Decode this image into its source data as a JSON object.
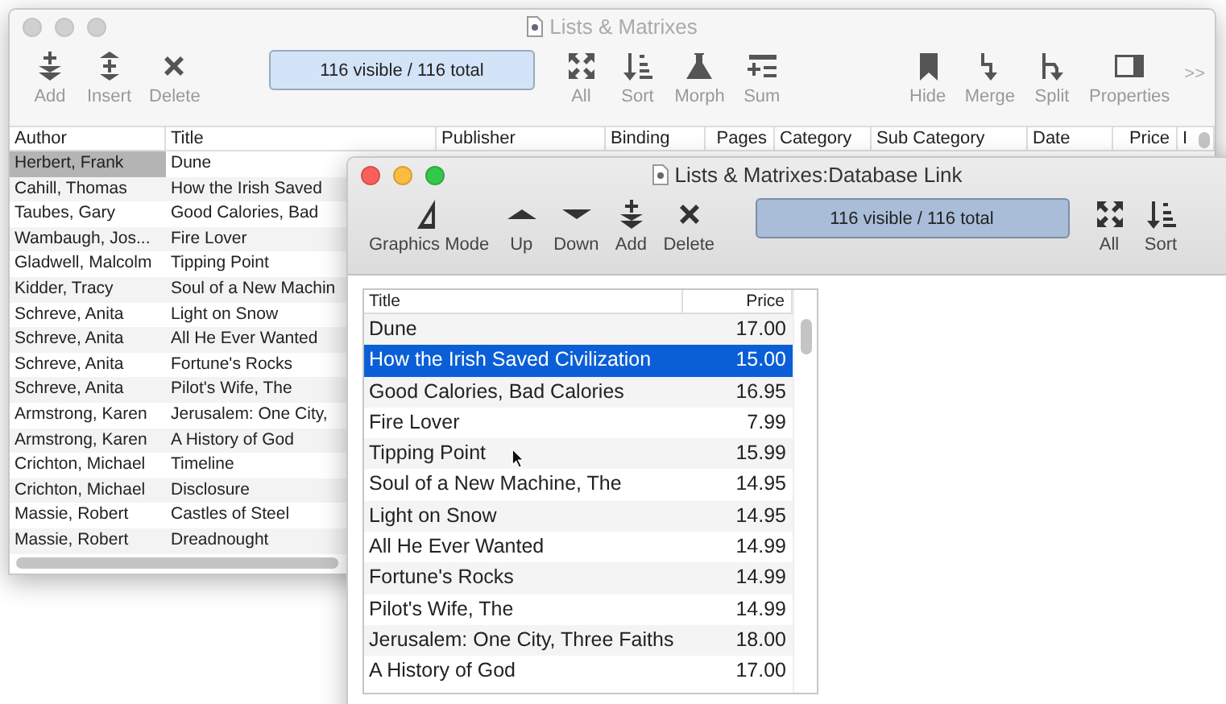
{
  "windows": [
    {
      "kind": "list",
      "active": false,
      "title": "Lists & Matrixes",
      "status": "116 visible / 116 total",
      "overflow": ">>",
      "toolbar": [
        [
          {
            "label": "Add",
            "kind": "add"
          },
          {
            "label": "Insert",
            "kind": "insert"
          },
          {
            "label": "Delete",
            "kind": "delete"
          }
        ],
        [
          {
            "label": "All",
            "kind": "all"
          },
          {
            "label": "Sort",
            "kind": "sort"
          },
          {
            "label": "Morph",
            "kind": "morph"
          },
          {
            "label": "Sum",
            "kind": "sum"
          }
        ],
        [
          {
            "label": "Hide",
            "kind": "hide"
          },
          {
            "label": "Merge",
            "kind": "merge"
          },
          {
            "label": "Split",
            "kind": "split"
          },
          {
            "label": "Properties",
            "kind": "properties"
          }
        ]
      ],
      "columns": [
        "Author",
        "Title",
        "Publisher",
        "Binding",
        "Pages",
        "Category",
        "Sub Category",
        "Date",
        "Price",
        "I"
      ],
      "rows": [
        {
          "cells": [
            "Herbert, Frank",
            "Dune"
          ],
          "selected": true
        },
        {
          "cells": [
            "Cahill, Thomas",
            "How the Irish Saved"
          ],
          "selected": false
        },
        {
          "cells": [
            "Taubes, Gary",
            "Good Calories, Bad"
          ],
          "selected": false
        },
        {
          "cells": [
            "Wambaugh, Jos...",
            "Fire Lover"
          ],
          "selected": false
        },
        {
          "cells": [
            "Gladwell, Malcolm",
            "Tipping Point"
          ],
          "selected": false
        },
        {
          "cells": [
            "Kidder, Tracy",
            "Soul of a New Machin"
          ],
          "selected": false
        },
        {
          "cells": [
            "Schreve, Anita",
            "Light on Snow"
          ],
          "selected": false
        },
        {
          "cells": [
            "Schreve, Anita",
            "All He Ever Wanted"
          ],
          "selected": false
        },
        {
          "cells": [
            "Schreve, Anita",
            "Fortune's Rocks"
          ],
          "selected": false
        },
        {
          "cells": [
            "Schreve, Anita",
            "Pilot's Wife, The"
          ],
          "selected": false
        },
        {
          "cells": [
            "Armstrong, Karen",
            "Jerusalem: One City,"
          ],
          "selected": false
        },
        {
          "cells": [
            "Armstrong, Karen",
            "A History of God"
          ],
          "selected": false
        },
        {
          "cells": [
            "Crichton, Michael",
            "Timeline"
          ],
          "selected": false
        },
        {
          "cells": [
            "Crichton, Michael",
            "Disclosure"
          ],
          "selected": false
        },
        {
          "cells": [
            "Massie, Robert",
            "Castles of Steel"
          ],
          "selected": false
        },
        {
          "cells": [
            "Massie, Robert",
            "Dreadnought"
          ],
          "selected": false
        }
      ]
    },
    {
      "kind": "link",
      "active": true,
      "title": "Lists & Matrixes:Database Link",
      "status": "116 visible / 116 total",
      "toolbar": [
        [
          {
            "label": "Graphics Mode",
            "kind": "graphics"
          },
          {
            "label": "Up",
            "kind": "up"
          },
          {
            "label": "Down",
            "kind": "down"
          },
          {
            "label": "Add",
            "kind": "add"
          },
          {
            "label": "Delete",
            "kind": "delete"
          }
        ],
        [
          {
            "label": "All",
            "kind": "all"
          },
          {
            "label": "Sort",
            "kind": "sort"
          }
        ]
      ],
      "columns": [
        "Title",
        "Price"
      ],
      "rows": [
        {
          "cells": [
            "Dune",
            "17.00"
          ],
          "selected": false
        },
        {
          "cells": [
            "How the Irish Saved Civilization",
            "15.00"
          ],
          "selected": true
        },
        {
          "cells": [
            "Good Calories, Bad Calories",
            "16.95"
          ],
          "selected": false
        },
        {
          "cells": [
            "Fire Lover",
            "7.99"
          ],
          "selected": false
        },
        {
          "cells": [
            "Tipping Point",
            "15.99"
          ],
          "selected": false
        },
        {
          "cells": [
            "Soul of a New Machine, The",
            "14.95"
          ],
          "selected": false
        },
        {
          "cells": [
            "Light on Snow",
            "14.95"
          ],
          "selected": false
        },
        {
          "cells": [
            "All He Ever Wanted",
            "14.99"
          ],
          "selected": false
        },
        {
          "cells": [
            "Fortune's Rocks",
            "14.99"
          ],
          "selected": false
        },
        {
          "cells": [
            "Pilot's Wife, The",
            "14.99"
          ],
          "selected": false
        },
        {
          "cells": [
            "Jerusalem: One City, Three Faiths",
            "18.00"
          ],
          "selected": false
        },
        {
          "cells": [
            "A History of God",
            "17.00"
          ],
          "selected": false
        }
      ]
    }
  ]
}
